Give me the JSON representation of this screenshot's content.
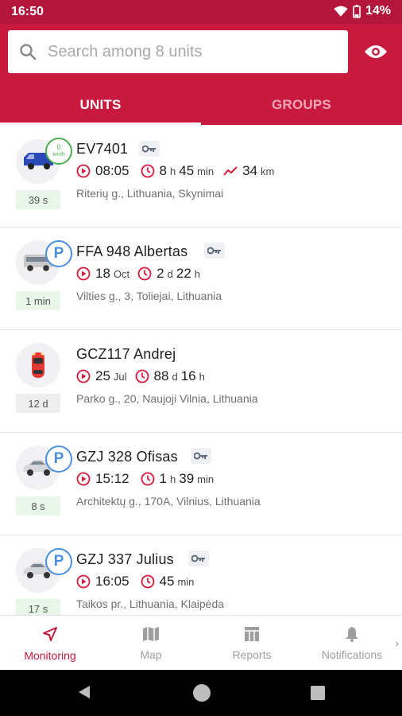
{
  "status_bar": {
    "time": "16:50",
    "battery": "14%"
  },
  "search": {
    "placeholder": "Search among 8 units"
  },
  "tabs": [
    {
      "label": "UNITS",
      "active": true
    },
    {
      "label": "GROUPS",
      "active": false
    }
  ],
  "units": [
    {
      "name": "EV7401",
      "has_key": true,
      "status": "moving",
      "speed_value": "0",
      "speed_unit": "km/h",
      "time": "08:05",
      "duration": [
        {
          "v": "8",
          "u": "h"
        },
        {
          "v": "45",
          "u": "min"
        }
      ],
      "distance": {
        "v": "34",
        "u": "km"
      },
      "address": "Riterių g., Lithuania, Skynimai",
      "age": "39 s",
      "age_style": "fresh",
      "vehicle": "blue-van"
    },
    {
      "name": "FFA 948 Albertas",
      "has_key": true,
      "status": "parked",
      "time_v": "18",
      "time_u": "Oct",
      "duration": [
        {
          "v": "2",
          "u": "d"
        },
        {
          "v": "22",
          "u": "h"
        }
      ],
      "address": "Vilties g., 3, Toliejai, Lithuania",
      "age": "1 min",
      "age_style": "fresh",
      "vehicle": "silver-van"
    },
    {
      "name": "GCZ117 Andrej",
      "has_key": false,
      "status": "none",
      "time_v": "25",
      "time_u": "Jul",
      "duration": [
        {
          "v": "88",
          "u": "d"
        },
        {
          "v": "16",
          "u": "h"
        }
      ],
      "address": "Parko g., 20, Naujoji Vilnia, Lithuania",
      "age": "12 d",
      "age_style": "old",
      "vehicle": "red-car"
    },
    {
      "name": "GZJ 328 Ofisas",
      "has_key": true,
      "status": "parked",
      "time": "15:12",
      "duration": [
        {
          "v": "1",
          "u": "h"
        },
        {
          "v": "39",
          "u": "min"
        }
      ],
      "address": "Architektų g., 170A, Vilnius, Lithuania",
      "age": "8 s",
      "age_style": "fresh",
      "vehicle": "silver-car"
    },
    {
      "name": "GZJ 337 Julius",
      "has_key": true,
      "status": "parked",
      "time": "16:05",
      "duration": [
        {
          "v": "45",
          "u": "min"
        }
      ],
      "address": "Taikos pr., Lithuania, Klaipėda",
      "age": "17 s",
      "age_style": "fresh",
      "vehicle": "silver-car"
    }
  ],
  "bottom_nav": [
    {
      "label": "Monitoring",
      "icon": "navigation-arrow-icon",
      "active": true
    },
    {
      "label": "Map",
      "icon": "map-icon",
      "active": false
    },
    {
      "label": "Reports",
      "icon": "reports-icon",
      "active": false
    },
    {
      "label": "Notifications",
      "icon": "bell-icon",
      "active": false
    }
  ],
  "colors": {
    "brand": "#c8193f",
    "status_bar": "#b3163a",
    "parked": "#4a8fe0",
    "moving": "#4caf50",
    "accent_icon": "#d81b3c"
  }
}
